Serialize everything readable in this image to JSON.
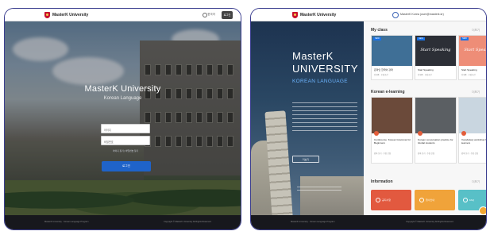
{
  "login_page": {
    "brand": "MasterK University",
    "lang_label": "한국어",
    "login_chip": "로그인",
    "title": "MasterK University",
    "subtitle": "Korean Language",
    "id_placeholder": "아이디",
    "pw_placeholder": "비밀번호",
    "find_link": "아이디 찾기 | 비밀번호 찾기",
    "login_button": "로그인",
    "footer_left": "MasterK University · Korean Language Program",
    "footer_right": "Copyright © MasterK University All Rights Reserved."
  },
  "dashboard": {
    "brand": "MasterK University",
    "user_label": "MasterK Korea (user@masterk.kr)",
    "hero_line1": "MasterK",
    "hero_line2": "UNIVERSITY",
    "hero_line3": "KOREAN LANGUAGE",
    "hero_button": "더보기",
    "my_class_title": "My class",
    "my_class_more": "더보기",
    "my_class_cards": [
      {
        "thumb_text": "",
        "badge": "NEW",
        "label": "온라인 한국어 강좌",
        "meta": "진행중 · 수강기간",
        "color": "#3f6f96"
      },
      {
        "thumb_text": "Start Speaking",
        "badge": "NEW",
        "label": "Start Speaking",
        "meta": "진행중 · 수강기간",
        "color": "#2c2f36"
      },
      {
        "thumb_text": "Start Speaking",
        "badge": "NEW",
        "label": "Start Speaking",
        "meta": "진행중 · 수강기간",
        "color": "#ee8d77"
      }
    ],
    "elearning_title": "Korean e-learning",
    "elearning_more": "더보기",
    "elearning_cards": [
      {
        "text": "Conference: Korean Grammar for Beginners",
        "meta": "강좌 보기 · 수강 신청",
        "color": "#6b4a3a"
      },
      {
        "text": "Korean conversation practice for Global students",
        "meta": "강좌 보기 · 수강 신청",
        "color": "#5b5f63"
      },
      {
        "text": "Vocabulary workshop for Korean learners",
        "meta": "강좌 보기 · 수강 신청",
        "color": "#c9d6e0"
      }
    ],
    "info_title": "Information",
    "info_more": "더보기",
    "info_cards": [
      {
        "label": "공지사항",
        "color": "#e2593f"
      },
      {
        "label": "행사안내",
        "color": "#f0a33a"
      },
      {
        "label": "FAQ",
        "color": "#58c0c7"
      }
    ],
    "footer_left": "MasterK University · Korean Language Program",
    "footer_right": "Copyright © MasterK University All Rights Reserved."
  }
}
